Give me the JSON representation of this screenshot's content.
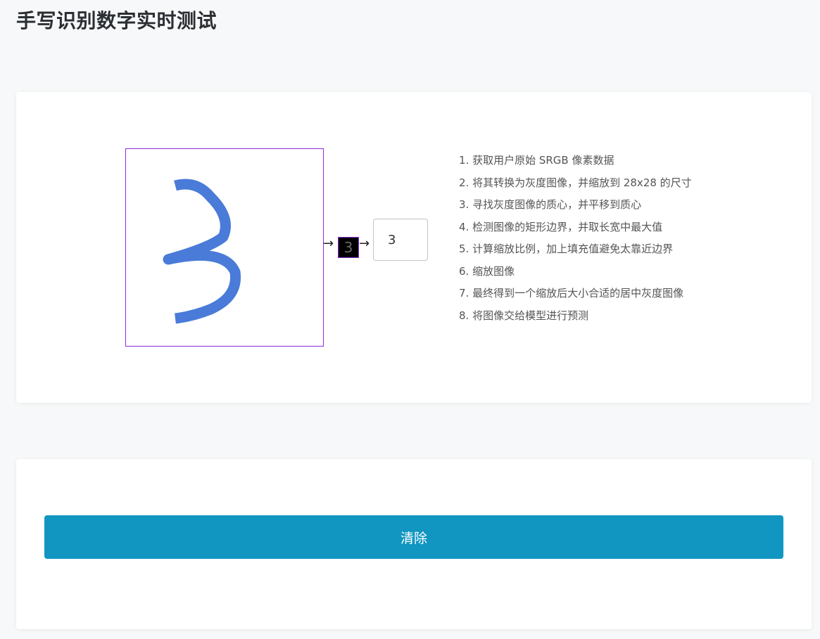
{
  "header": {
    "title": "手写识别数字实时测试"
  },
  "pipeline": {
    "arrow_glyph": "→",
    "thumbnail_digit": "3",
    "prediction": "3",
    "stroke_color": "#4a7bd8",
    "frame_color": "#8a2be2"
  },
  "steps": [
    "1. 获取用户原始 SRGB 像素数据",
    "2. 将其转换为灰度图像，并缩放到 28x28 的尺寸",
    "3. 寻找灰度图像的质心，并平移到质心",
    "4. 检测图像的矩形边界，并取长宽中最大值",
    "5. 计算缩放比例，加上填充值避免太靠近边界",
    "6. 缩放图像",
    "7. 最终得到一个缩放后大小合适的居中灰度图像",
    "8. 将图像交给模型进行预测"
  ],
  "actions": {
    "clear_label": "清除",
    "button_color": "#1196c1"
  }
}
